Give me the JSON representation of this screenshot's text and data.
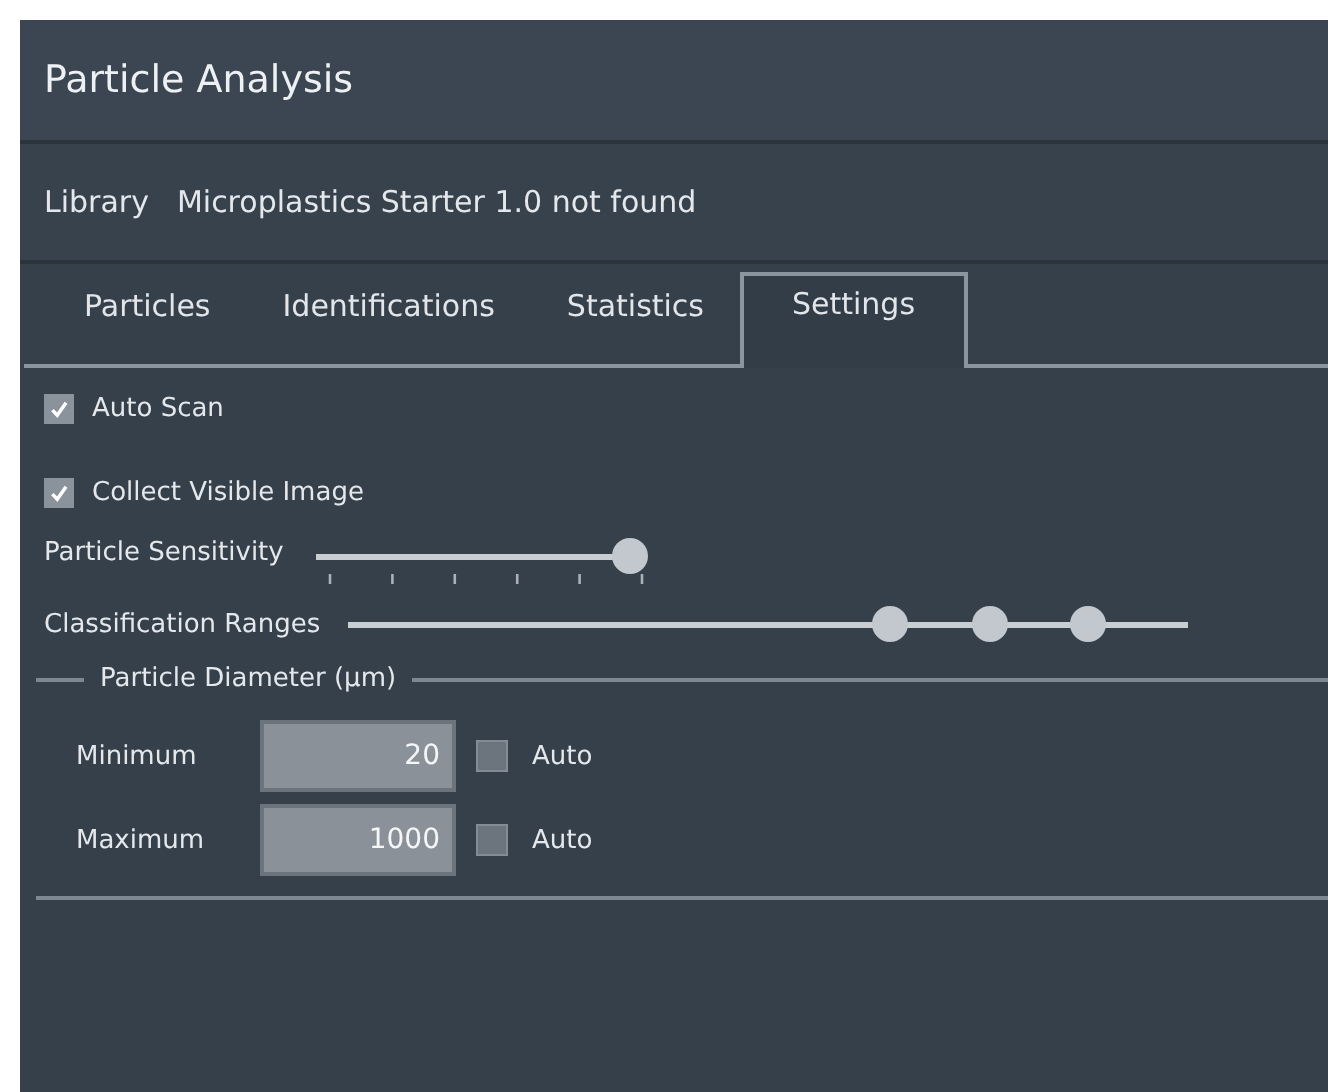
{
  "window": {
    "title": "Particle Analysis"
  },
  "library": {
    "label": "Library",
    "value": "Microplastics Starter 1.0 not found"
  },
  "tabs": [
    {
      "label": "Particles",
      "selected": false
    },
    {
      "label": "Identifications",
      "selected": false
    },
    {
      "label": "Statistics",
      "selected": false
    },
    {
      "label": "Settings",
      "selected": true
    }
  ],
  "options": [
    {
      "label": "Auto Scan",
      "checked": true
    },
    {
      "label": "Collect Visible Image",
      "checked": true
    }
  ],
  "sensitivity": {
    "label": "Particle Sensitivity",
    "level": 1
  },
  "classification": {
    "label": "Classification Ranges",
    "thumbs": [
      {
        "level": 0.645
      },
      {
        "level": 0.764
      },
      {
        "level": 0.881
      }
    ]
  },
  "diameter": {
    "title": "Particle Diameter (µm)",
    "rows": [
      {
        "label": "Minimum",
        "value": "20",
        "auto_label": "Auto",
        "auto_checked": false
      },
      {
        "label": "Maximum",
        "value": "1000",
        "auto_label": "Auto",
        "auto_checked": false
      }
    ]
  }
}
